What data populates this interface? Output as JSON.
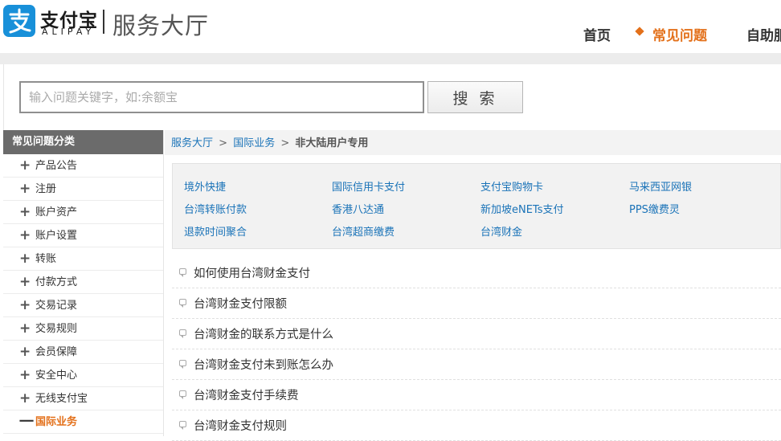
{
  "header": {
    "logo_cn": "支付宝",
    "logo_en": "ALIPAY",
    "hall_title": "服务大厅",
    "nav": {
      "home": "首页",
      "faq": "常见问题",
      "self_service": "自助服务"
    },
    "accent_color": "#e3701a",
    "brand_color": "#1890d9"
  },
  "search": {
    "placeholder": "输入问题关键字，如:余额宝",
    "value": "",
    "button_label": "搜 索"
  },
  "sidebar": {
    "title": "常见问题分类",
    "items": [
      {
        "label": "产品公告",
        "icon": "plus-icon"
      },
      {
        "label": "注册",
        "icon": "plus-icon"
      },
      {
        "label": "账户资产",
        "icon": "plus-icon"
      },
      {
        "label": "账户设置",
        "icon": "plus-icon"
      },
      {
        "label": "转账",
        "icon": "plus-icon"
      },
      {
        "label": "付款方式",
        "icon": "plus-icon"
      },
      {
        "label": "交易记录",
        "icon": "plus-icon"
      },
      {
        "label": "交易规则",
        "icon": "plus-icon"
      },
      {
        "label": "会员保障",
        "icon": "plus-icon"
      },
      {
        "label": "安全中心",
        "icon": "plus-icon"
      },
      {
        "label": "无线支付宝",
        "icon": "plus-icon"
      },
      {
        "label": "国际业务",
        "icon": "minus-icon",
        "active": true,
        "expand_symbol": "一"
      }
    ]
  },
  "breadcrumb": {
    "items": [
      "服务大厅",
      "国际业务"
    ],
    "separator": ">",
    "current": "非大陆用户专用"
  },
  "categories": [
    "境外快捷",
    "国际信用卡支付",
    "支付宝购物卡",
    "马来西亚网银",
    "台湾转账付款",
    "香港八达通",
    "新加坡eNETs支付",
    "PPS缴费灵",
    "退款时间聚合",
    "台湾超商缴费",
    "台湾财金"
  ],
  "questions": [
    "如何使用台湾财金支付",
    "台湾财金支付限额",
    "台湾财金的联系方式是什么",
    "台湾财金支付未到账怎么办",
    "台湾财金支付手续费",
    "台湾财金支付规则"
  ]
}
